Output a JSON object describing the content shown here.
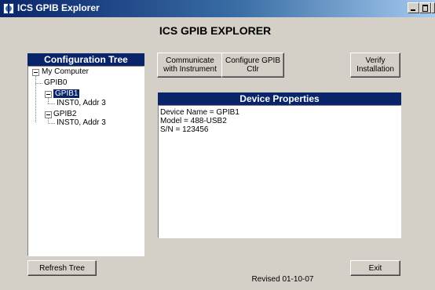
{
  "window": {
    "title": "ICS GPIB Explorer"
  },
  "app": {
    "heading": "ICS GPIB EXPLORER"
  },
  "config_tree": {
    "header": "Configuration Tree",
    "root": "My Computer",
    "items": [
      "GPIB0",
      "GPIB1",
      "INST0, Addr  3",
      "GPIB2",
      "INST0, Addr  3"
    ]
  },
  "buttons": {
    "communicate": "Communicate with Instrument",
    "configure": "Configure GPIB Ctlr",
    "verify": "Verify Installation",
    "refresh": "Refresh Tree",
    "exit": "Exit"
  },
  "device_properties": {
    "header": "Device Properties",
    "lines": [
      "Device Name = GPIB1",
      "Model = 488-USB2",
      "S/N = 123456"
    ]
  },
  "footer": {
    "revised": "Revised 01-10-07"
  },
  "colors": {
    "titlebar": "#0a246a",
    "selection": "#0a246a",
    "panel_header": "#0a246a",
    "window_bg": "#d4d0c8"
  }
}
